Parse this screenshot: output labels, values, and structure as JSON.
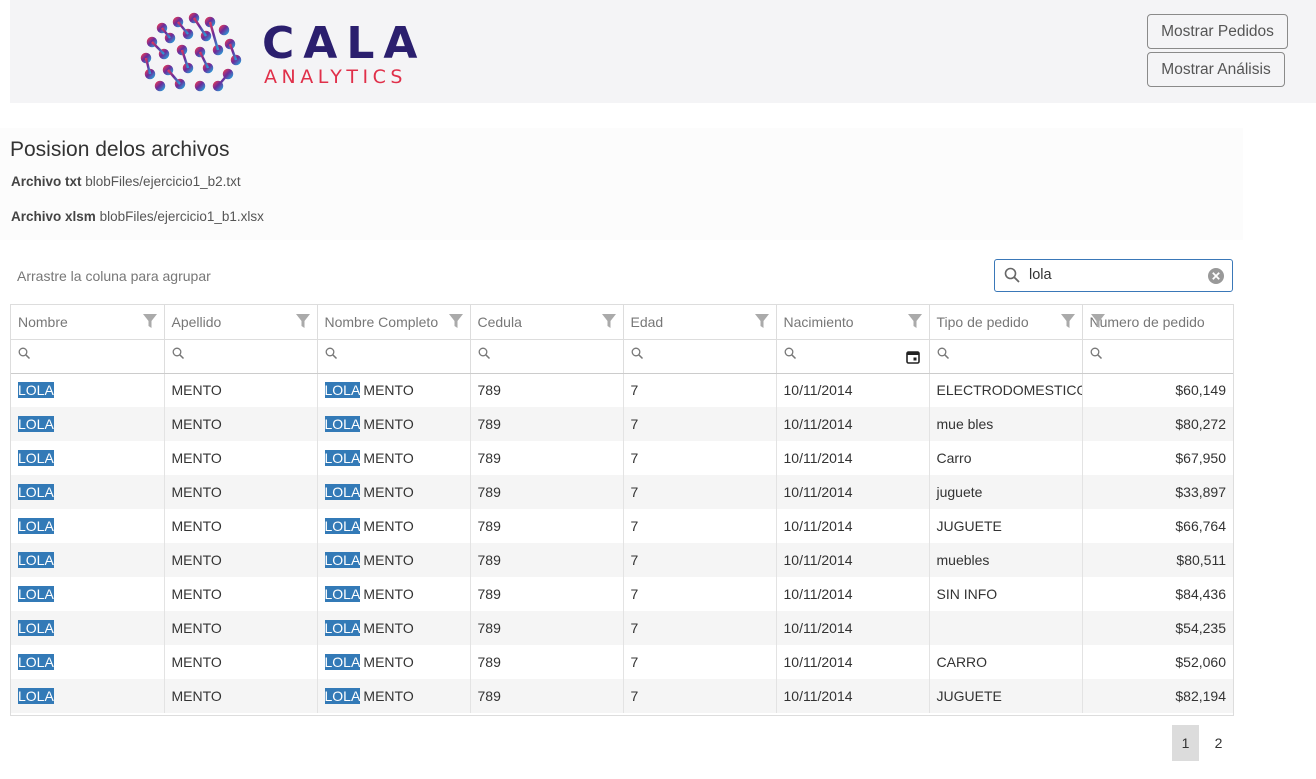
{
  "brand": {
    "name": "CALA",
    "sub": "ANALYTICS"
  },
  "header": {
    "btn_pedidos": "Mostrar Pedidos",
    "btn_analisis": "Mostrar Análisis"
  },
  "files": {
    "title": "Posision delos archivos",
    "txt_label": "Archivo txt",
    "txt_path": "blobFiles/ejercicio1_b2.txt",
    "xlsm_label": "Archivo xlsm",
    "xlsm_path": "blobFiles/ejercicio1_b1.xlsx"
  },
  "grid": {
    "group_hint": "Arrastre la coluna para agrupar",
    "search_value": "lola",
    "columns": [
      "Nombre",
      "Apellido",
      "Nombre Completo",
      "Cedula",
      "Edad",
      "Nacimiento",
      "Tipo de pedido",
      "Numero de pedido"
    ],
    "rows": [
      [
        "LOLA",
        "MENTO",
        "LOLA",
        "MENTO",
        "789",
        "7",
        "10/11/2014",
        "ELECTRODOMESTICO",
        "$60,149"
      ],
      [
        "LOLA",
        "MENTO",
        "LOLA",
        "MENTO",
        "789",
        "7",
        "10/11/2014",
        "mue bles",
        "$80,272"
      ],
      [
        "LOLA",
        "MENTO",
        "LOLA",
        "MENTO",
        "789",
        "7",
        "10/11/2014",
        "Carro",
        "$67,950"
      ],
      [
        "LOLA",
        "MENTO",
        "LOLA",
        "MENTO",
        "789",
        "7",
        "10/11/2014",
        "juguete",
        "$33,897"
      ],
      [
        "LOLA",
        "MENTO",
        "LOLA",
        "MENTO",
        "789",
        "7",
        "10/11/2014",
        "JUGUETE",
        "$66,764"
      ],
      [
        "LOLA",
        "MENTO",
        "LOLA",
        "MENTO",
        "789",
        "7",
        "10/11/2014",
        "muebles",
        "$80,511"
      ],
      [
        "LOLA",
        "MENTO",
        "LOLA",
        "MENTO",
        "789",
        "7",
        "10/11/2014",
        "SIN INFO",
        "$84,436"
      ],
      [
        "LOLA",
        "MENTO",
        "LOLA",
        "MENTO",
        "789",
        "7",
        "10/11/2014",
        "",
        "$54,235"
      ],
      [
        "LOLA",
        "MENTO",
        "LOLA",
        "MENTO",
        "789",
        "7",
        "10/11/2014",
        "CARRO",
        "$52,060"
      ],
      [
        "LOLA",
        "MENTO",
        "LOLA",
        "MENTO",
        "789",
        "7",
        "10/11/2014",
        "JUGUETE",
        "$82,194"
      ]
    ]
  },
  "pager": {
    "pages": [
      "1",
      "2"
    ],
    "current": "1"
  },
  "icons": {
    "search": "search-icon",
    "filter": "filter-icon",
    "clear": "clear-icon",
    "calendar": "calendar-icon"
  },
  "colors": {
    "highlight": "#337ab7",
    "brand_dark": "#2b1f6e",
    "brand_red": "#e0304a",
    "search_border": "#3a78b8"
  }
}
